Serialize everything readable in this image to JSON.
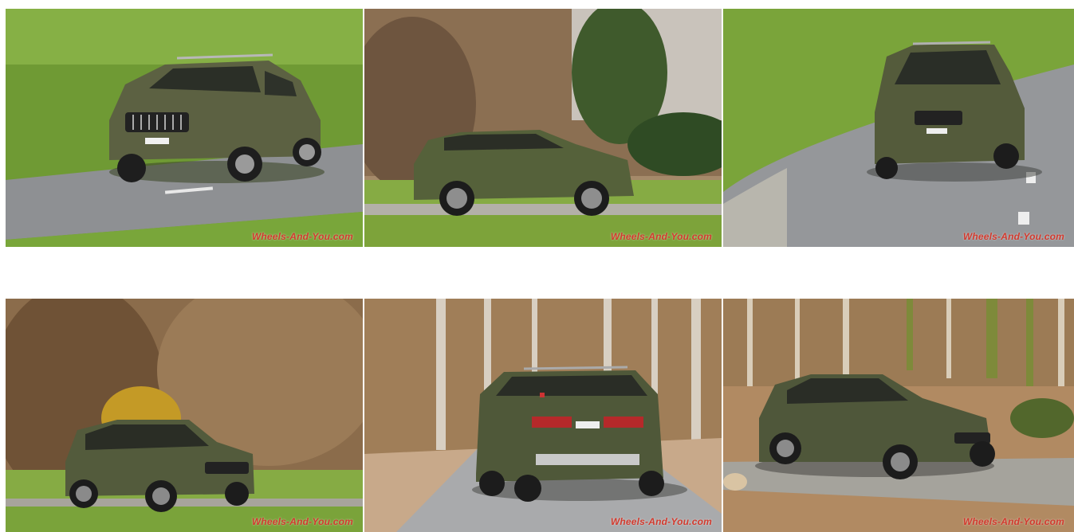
{
  "gallery": {
    "photos": [
      {
        "subject": "suv-front-three-quarter-on-road",
        "watermark": "Wheels-And-You.com"
      },
      {
        "subject": "suv-side-panning",
        "watermark": "Wheels-And-You.com"
      },
      {
        "subject": "suv-front-on-curved-road",
        "watermark": "Wheels-And-You.com"
      },
      {
        "subject": "suv-front-three-quarter-panning",
        "watermark": "Wheels-And-You.com"
      },
      {
        "subject": "suv-rear-forest-road",
        "watermark": "Wheels-And-You.com"
      },
      {
        "subject": "suv-offroad-forest",
        "watermark": "Wheels-And-You.com"
      }
    ]
  },
  "colors": {
    "car_body": "#5a5f3e",
    "grass": "#7fa83a",
    "road": "#8a8c8f",
    "forest": "#8a6a45",
    "watermark": "#d23a2e"
  }
}
